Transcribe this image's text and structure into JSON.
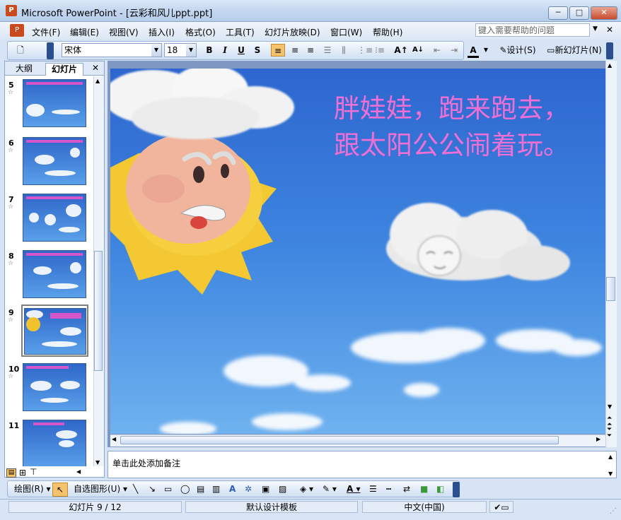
{
  "window": {
    "title": "Microsoft PowerPoint - [云彩和风儿ppt.ppt]",
    "minimize_glyph": "─",
    "maximize_glyph": "□",
    "close_glyph": "✕"
  },
  "menu": {
    "items": [
      "文件(F)",
      "编辑(E)",
      "视图(V)",
      "插入(I)",
      "格式(O)",
      "工具(T)",
      "幻灯片放映(D)",
      "窗口(W)",
      "帮助(H)"
    ],
    "help_placeholder": "键入需要帮助的问题"
  },
  "toolbar": {
    "font_name": "宋体",
    "font_size": "18",
    "bold": "B",
    "italic": "I",
    "underline": "U",
    "shadow": "S",
    "increase_font": "A↑",
    "decrease_font": "A↓",
    "font_color_label": "A",
    "design_label": "设计(S)",
    "new_slide_label": "新幻灯片(N)"
  },
  "left_pane": {
    "tab_outline": "大纲",
    "tab_slides": "幻灯片",
    "close_glyph": "✕",
    "slides": [
      {
        "number": "5"
      },
      {
        "number": "6"
      },
      {
        "number": "7"
      },
      {
        "number": "8"
      },
      {
        "number": "9",
        "selected": true
      },
      {
        "number": "10"
      },
      {
        "number": "11"
      }
    ],
    "star_glyph": "☆"
  },
  "slide": {
    "line1": "胖娃娃，跑来跑去，",
    "line2": "跟太阳公公闹着玩。",
    "text_color": "#f06fd4"
  },
  "notes": {
    "placeholder": "单击此处添加备注"
  },
  "drawbar": {
    "draw_label": "绘图(R)",
    "autoshapes_label": "自选图形(U)"
  },
  "status": {
    "slide_position": "幻灯片 9 / 12",
    "template": "默认设计模板",
    "language": "中文(中国)"
  }
}
